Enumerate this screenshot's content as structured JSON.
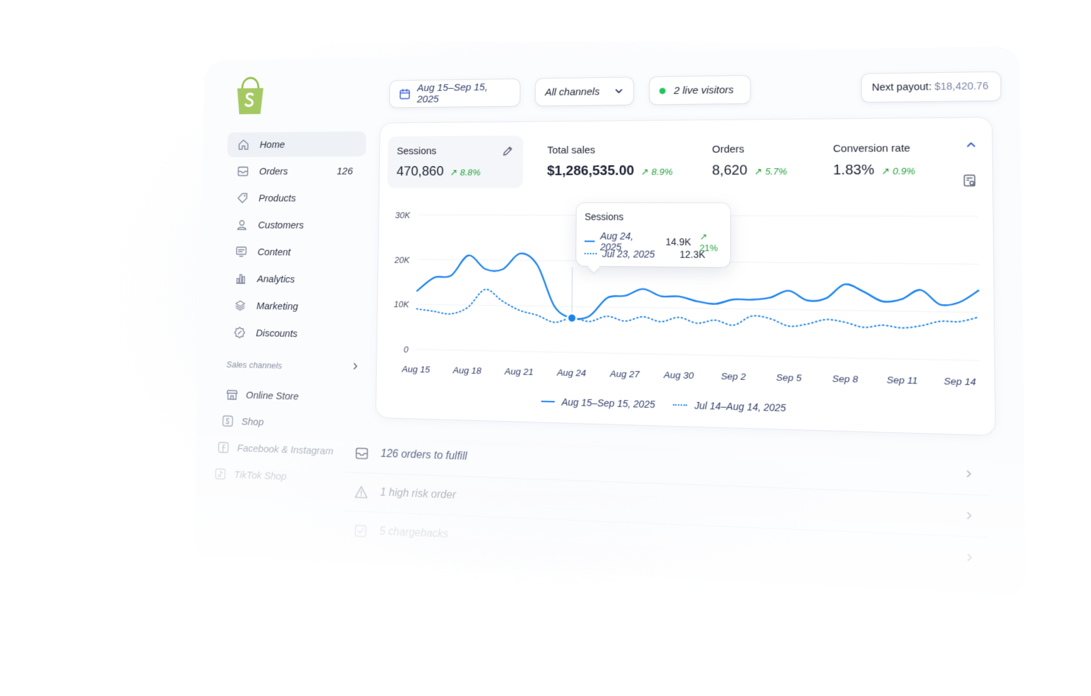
{
  "brand": {
    "logo_icon": "shopify-bag-icon",
    "accent": "#95bf47"
  },
  "sidebar": {
    "items": [
      {
        "label": "Home",
        "icon": "home-icon",
        "active": true
      },
      {
        "label": "Orders",
        "icon": "inbox-icon",
        "count": "126"
      },
      {
        "label": "Products",
        "icon": "tag-icon"
      },
      {
        "label": "Customers",
        "icon": "person-icon"
      },
      {
        "label": "Content",
        "icon": "content-icon"
      },
      {
        "label": "Analytics",
        "icon": "bar-chart-icon"
      },
      {
        "label": "Marketing",
        "icon": "layers-icon"
      },
      {
        "label": "Discounts",
        "icon": "discount-badge-icon"
      }
    ],
    "sales_channels_label": "Sales channels",
    "channels": [
      {
        "label": "Online Store",
        "icon": "store-icon"
      },
      {
        "label": "Shop",
        "icon": "shop-icon"
      },
      {
        "label": "Facebook & Instagram",
        "icon": "facebook-icon"
      },
      {
        "label": "TikTok Shop",
        "icon": "tiktok-icon"
      }
    ]
  },
  "topbar": {
    "date_range": "Aug 15–Sep 15, 2025",
    "channels_select": "All channels",
    "live_visitors": "2 live visitors",
    "payout_label": "Next payout:",
    "payout_amount": "$18,420.76"
  },
  "metrics": [
    {
      "label": "Sessions",
      "value": "470,860",
      "delta": "8.8%"
    },
    {
      "label": "Total sales",
      "value": "$1,286,535.00",
      "delta": "8.9%"
    },
    {
      "label": "Orders",
      "value": "8,620",
      "delta": "5.7%"
    },
    {
      "label": "Conversion rate",
      "value": "1.83%",
      "delta": "0.9%"
    }
  ],
  "tooltip": {
    "title": "Sessions",
    "current_date": "Aug 24, 2025",
    "current_value": "14.9K",
    "current_delta": "21%",
    "previous_date": "Jul 23, 2025",
    "previous_value": "12.3K"
  },
  "legend": {
    "current": "Aug 15–Sep 15, 2025",
    "previous": "Jul 14–Aug 14, 2025"
  },
  "tasks": [
    {
      "label": "126 orders to fulfill",
      "icon": "inbox-icon"
    },
    {
      "label": "1 high risk order",
      "icon": "warning-icon"
    },
    {
      "label": "5 chargebacks",
      "icon": "chargeback-icon"
    }
  ],
  "colors": {
    "series": "#1a82f0",
    "positive": "#22a33c",
    "live": "#22c55e"
  },
  "chart_data": {
    "type": "line",
    "ylabel": "",
    "xlabel": "",
    "ylim": [
      0,
      30000
    ],
    "y_ticks": [
      "0",
      "10K",
      "20K",
      "30K"
    ],
    "y_tick_values": [
      0,
      10000,
      20000,
      30000
    ],
    "x_tick_labels": [
      "Aug 15",
      "Aug 18",
      "Aug 21",
      "Aug 24",
      "Aug 27",
      "Aug 30",
      "Sep 2",
      "Sep 5",
      "Sep 8",
      "Sep 11",
      "Sep 14"
    ],
    "x_tick_index": [
      0,
      3,
      6,
      9,
      12,
      15,
      18,
      21,
      24,
      27,
      30
    ],
    "grid": true,
    "series": [
      {
        "name": "Aug 15–Sep 15, 2025",
        "style": "solid",
        "values": [
          13000,
          16000,
          16500,
          21000,
          18000,
          18000,
          21500,
          19000,
          10000,
          7500,
          8000,
          12000,
          12500,
          14000,
          12500,
          12500,
          11500,
          11000,
          12000,
          12000,
          12500,
          14000,
          12000,
          12500,
          15500,
          14000,
          12000,
          12500,
          14500,
          11500,
          12000,
          14500
        ]
      },
      {
        "name": "Jul 14–Aug 14, 2025",
        "style": "dotted",
        "values": [
          9000,
          8500,
          8000,
          9500,
          13500,
          11000,
          9000,
          8000,
          6500,
          7500,
          6800,
          8000,
          7000,
          8000,
          7000,
          8000,
          6800,
          7500,
          6500,
          8500,
          8000,
          6500,
          7000,
          8000,
          7500,
          6500,
          7000,
          6500,
          7000,
          8000,
          8000,
          9000
        ]
      }
    ],
    "highlight": {
      "series": 0,
      "index": 9
    }
  }
}
